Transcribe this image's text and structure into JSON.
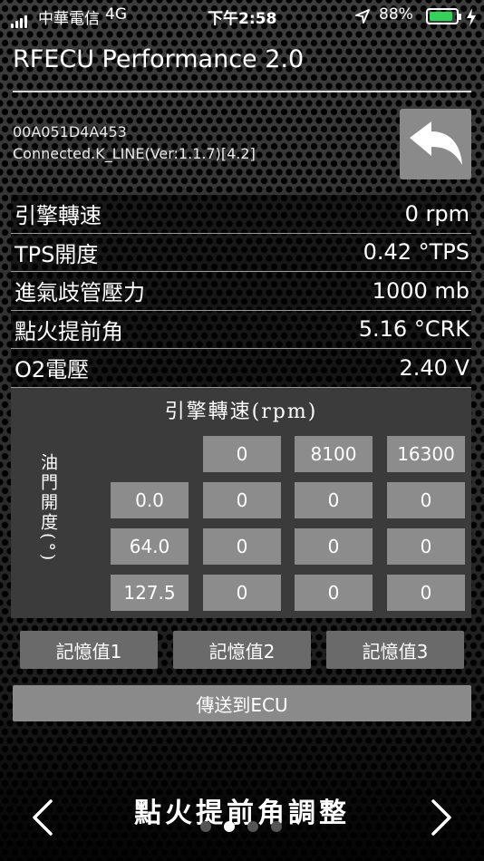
{
  "status_bar": {
    "carrier": "中華電信",
    "network": "4G",
    "time": "下午2:58",
    "battery_percent": "88%",
    "battery_level": 0.88,
    "colors": {
      "battery_fill": "#34d058"
    },
    "icons": [
      "signal-icon",
      "location-arrow-icon",
      "battery-icon",
      "charging-bolt-icon"
    ]
  },
  "header": {
    "title": "RFECU Performance 2.0",
    "device_id": "00A051D4A453",
    "connection": "Connected.K_LINE(Ver:1.1.7)[4.2]",
    "back_icon": "back-arrow-icon"
  },
  "readings": [
    {
      "label": "引擎轉速",
      "value": "0 rpm"
    },
    {
      "label": "TPS開度",
      "value": "0.42 °TPS"
    },
    {
      "label": "進氣歧管壓力",
      "value": "1000 mb"
    },
    {
      "label": "點火提前角",
      "value": "5.16 °CRK"
    },
    {
      "label": "O2電壓",
      "value": "2.40 V"
    }
  ],
  "map": {
    "title": "引擎轉速(rpm)",
    "y_label": "油門開度(°)",
    "rpm_columns": [
      "0",
      "8100",
      "16300"
    ],
    "throttle_rows": [
      "0.0",
      "64.0",
      "127.5"
    ],
    "values": [
      [
        "0",
        "0",
        "0"
      ],
      [
        "0",
        "0",
        "0"
      ],
      [
        "0",
        "0",
        "0"
      ]
    ]
  },
  "memory_buttons": [
    "記憶值1",
    "記憶值2",
    "記憶值3"
  ],
  "send_button": "傳送到ECU",
  "footer": {
    "page_title": "點火提前角調整",
    "page_count": 4,
    "active_page": 2
  }
}
